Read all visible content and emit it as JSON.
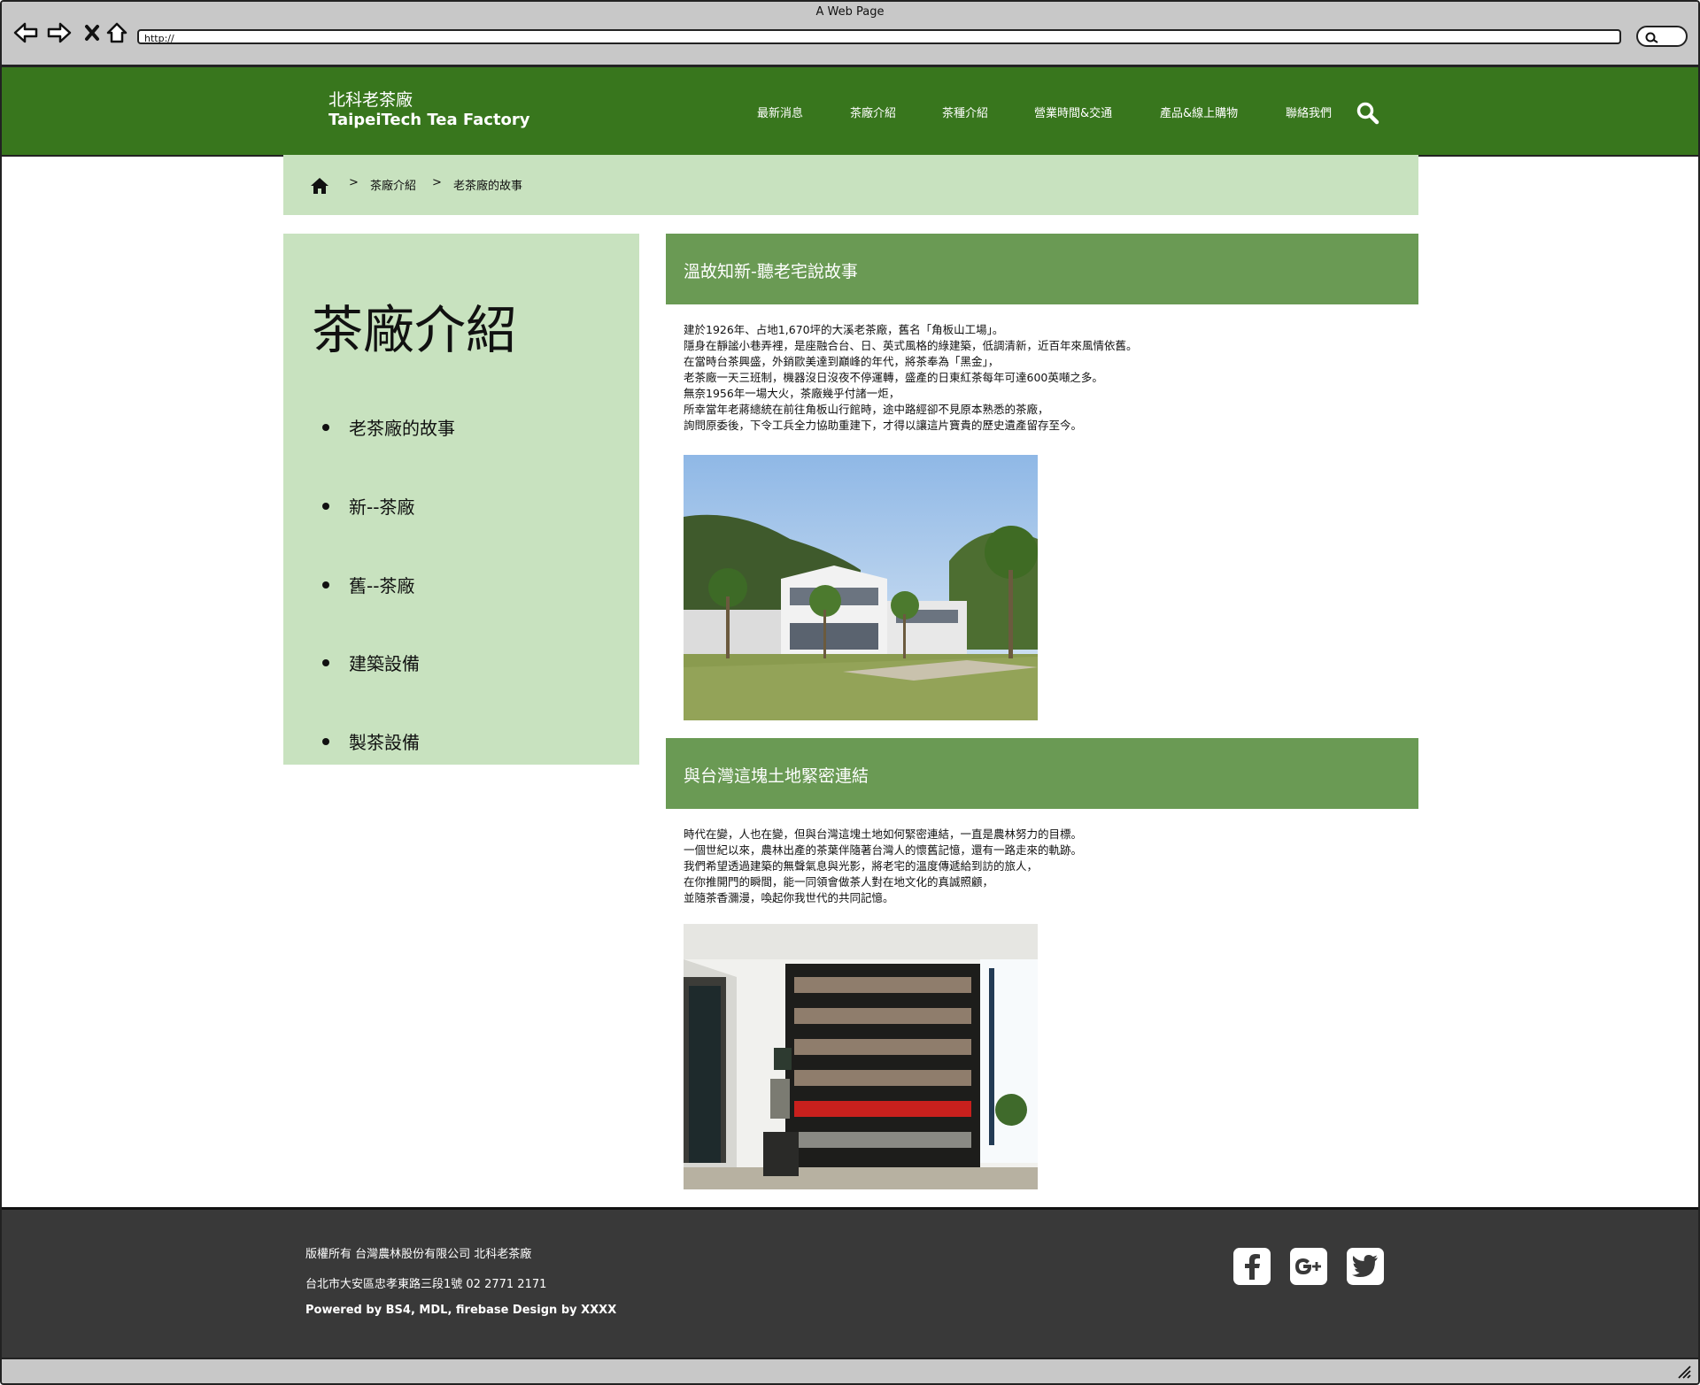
{
  "browser": {
    "window_title": "A Web Page",
    "url": "http://"
  },
  "header": {
    "brand_zh": "北科老茶廠",
    "brand_en": "TaipeiTech Tea Factory",
    "nav": [
      "最新消息",
      "茶廠介紹",
      "茶種介紹",
      "營業時間&交通",
      "產品&線上購物",
      "聯絡我們"
    ]
  },
  "breadcrumb": {
    "separator": ">",
    "items": [
      "茶廠介紹",
      "老茶廠的故事"
    ]
  },
  "sidebar": {
    "title": "茶廠介紹",
    "items": [
      "老茶廠的故事",
      "新--茶廠",
      "舊--茶廠",
      "建築設備",
      "製茶設備"
    ]
  },
  "sections": [
    {
      "heading": "溫故知新-聽老宅說故事",
      "lines": [
        "建於1926年、占地1,670坪的大溪老茶廠，舊名「角板山工場」。",
        "隱身在靜謐小巷弄裡，是座融合台、日、英式風格的綠建築，低調清新，近百年來風情依舊。",
        "在當時台茶興盛，外銷歐美達到巔峰的年代，將茶奉為「黑金」，",
        "老茶廠一天三班制，機器沒日沒夜不停運轉，盛產的日東紅茶每年可達600英噸之多。",
        "無奈1956年一場大火，茶廠幾乎付諸一炬，",
        "所幸當年老蔣總統在前往角板山行館時，途中路經卻不見原本熟悉的茶廠，",
        "詢問原委後，下令工兵全力協助重建下，才得以讓這片寶貴的歷史遺產留存至今。"
      ]
    },
    {
      "heading": "與台灣這塊土地緊密連結",
      "lines": [
        "時代在變，人也在變，但與台灣這塊土地如何緊密連結，一直是農林努力的目標。",
        "一個世紀以來，農林出產的茶葉伴隨著台灣人的懷舊記憶，還有一路走來的軌跡。",
        "我們希望透過建築的無聲氣息與光影，將老宅的溫度傳遞給到訪的旅人，",
        "在你推開門的瞬間，能一同領會做茶人對在地文化的真誠照顧，",
        "並隨茶香瀰漫，喚起你我世代的共同記憶。"
      ]
    }
  ],
  "footer": {
    "copyright": "版權所有 台灣農林股份有限公司 北科老茶廠",
    "address": "台北市大安區忠孝東路三段1號 02 2771 2171",
    "credits": "Powered by BS4, MDL, firebase Design by XXXX",
    "social": [
      "facebook-icon",
      "google-plus-icon",
      "twitter-icon"
    ]
  },
  "colors": {
    "header_green": "#38761d",
    "section_green": "#6a9a54",
    "light_green": "#c8e2bf",
    "footer_dark": "#393939"
  }
}
